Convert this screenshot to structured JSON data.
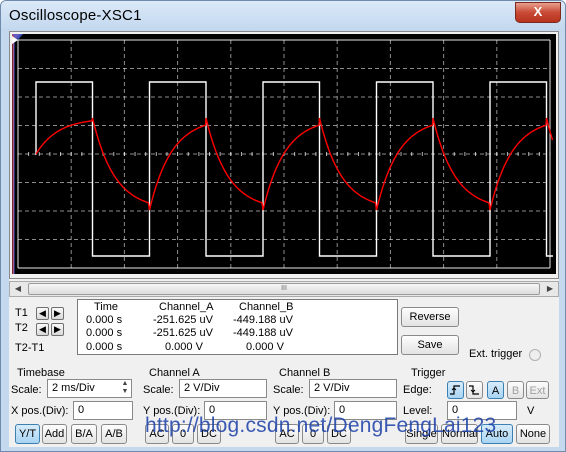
{
  "window": {
    "title": "Oscilloscope-XSC1",
    "close_label": "X"
  },
  "screen": {
    "background": "#000000",
    "channel_a_color": "#ff0000",
    "channel_b_color": "#ffffff",
    "grid_color": "#ffffff",
    "cursor_1_color": "#ff0000",
    "cursor_2_color": "#3a57d8"
  },
  "scrollbar": {
    "left_arrow": "left-arrow",
    "right_arrow": "right-arrow",
    "thumb_grip": "III"
  },
  "cursors": {
    "t1_label": "T1",
    "t2_label": "T2",
    "t2t1_label": "T2-T1"
  },
  "readout": {
    "headers": {
      "time": "Time",
      "channel_a": "Channel_A",
      "channel_b": "Channel_B"
    },
    "rows": [
      {
        "time": "0.000 s",
        "channel_a": "-251.625 uV",
        "channel_b": "-449.188 uV"
      },
      {
        "time": "0.000 s",
        "channel_a": "-251.625 uV",
        "channel_b": "-449.188 uV"
      },
      {
        "time": "0.000 s",
        "channel_a": "0.000 V",
        "channel_b": "0.000 V"
      }
    ]
  },
  "actions": {
    "reverse": "Reverse",
    "save": "Save",
    "ext_trigger": "Ext. trigger"
  },
  "timebase": {
    "title": "Timebase",
    "scale_label": "Scale:",
    "scale_value": "2 ms/Div",
    "xpos_label": "X pos.(Div):",
    "xpos_value": "0",
    "modes": [
      "Y/T",
      "Add",
      "B/A",
      "A/B"
    ],
    "active_mode": "Y/T"
  },
  "channel_a": {
    "title": "Channel A",
    "scale_label": "Scale:",
    "scale_value": "2  V/Div",
    "ypos_label": "Y pos.(Div):",
    "ypos_value": "0",
    "coupling": [
      "AC",
      "0",
      "DC"
    ]
  },
  "channel_b": {
    "title": "Channel B",
    "scale_label": "Scale:",
    "scale_value": "2  V/Div",
    "ypos_label": "Y pos.(Div):",
    "ypos_value": "0",
    "coupling": [
      "AC",
      "0",
      "DC"
    ]
  },
  "trigger": {
    "title": "Trigger",
    "edge_label": "Edge:",
    "sources": [
      "A",
      "B",
      "Ext"
    ],
    "active_source": "A",
    "level_label": "Level:",
    "level_value": "0",
    "level_unit": "V",
    "modes": [
      "Single",
      "Normal",
      "Auto",
      "None"
    ]
  },
  "watermark": "http://blog.csdn.net/DengFengLai123"
}
